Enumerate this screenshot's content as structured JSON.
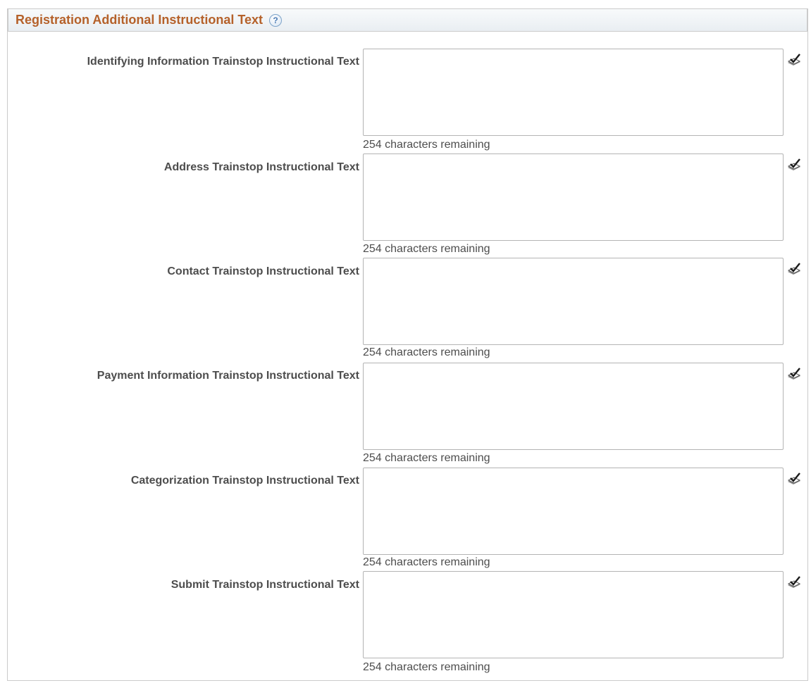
{
  "section": {
    "title": "Registration Additional Instructional Text",
    "help_icon": "question-circle-icon"
  },
  "fields": [
    {
      "label": "Identifying Information Trainstop Instructional Text",
      "value": "",
      "counter": "254 characters remaining",
      "icon": "spell-check-icon"
    },
    {
      "label": "Address Trainstop Instructional Text",
      "value": "",
      "counter": "254 characters remaining",
      "icon": "spell-check-icon"
    },
    {
      "label": "Contact Trainstop Instructional Text",
      "value": "",
      "counter": "254 characters remaining",
      "icon": "spell-check-icon"
    },
    {
      "label": "Payment Information Trainstop Instructional Text",
      "value": "",
      "counter": "254 characters remaining",
      "icon": "spell-check-icon"
    },
    {
      "label": "Categorization Trainstop Instructional Text",
      "value": "",
      "counter": "254 characters remaining",
      "icon": "spell-check-icon"
    },
    {
      "label": "Submit Trainstop Instructional Text",
      "value": "",
      "counter": "254 characters remaining",
      "icon": "spell-check-icon"
    }
  ],
  "colors": {
    "title": "#b5612a",
    "label": "#4d4d4d",
    "border": "#b4b4b4"
  }
}
